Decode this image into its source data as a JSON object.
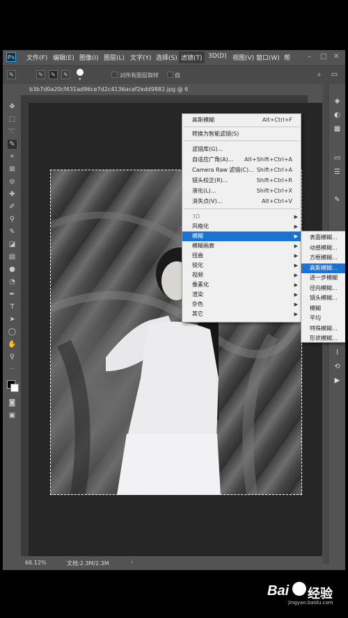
{
  "menubar": {
    "logo": "Ps",
    "items": [
      "文件(F)",
      "编辑(E)",
      "图像(I)",
      "图层(L)",
      "文字(Y)",
      "选择(S)",
      "滤镜(T)",
      "3D(D)",
      "视图(V)",
      "窗口(W)",
      "帮"
    ]
  },
  "options": {
    "sample_all_layers": "对所有图层取样",
    "auto_enhance": "自"
  },
  "document": {
    "tab_title": "b3b7d0a20cf431ad96ce7d2c4136acaf2edd9882.jpg @ 6",
    "zoom": "66.12%",
    "doc_size": "文档:2.3M/2.3M"
  },
  "filter_menu": {
    "items": [
      {
        "label": "高斯模糊",
        "shortcut": "Alt+Ctrl+F"
      },
      {
        "label": "转换为智能滤镜(S)",
        "shortcut": ""
      },
      {
        "label": "滤镜库(G)...",
        "shortcut": ""
      },
      {
        "label": "自适应广角(A)...",
        "shortcut": "Alt+Shift+Ctrl+A"
      },
      {
        "label": "Camera Raw 滤镜(C)...",
        "shortcut": "Shift+Ctrl+A"
      },
      {
        "label": "镜头校正(R)...",
        "shortcut": "Shift+Ctrl+R"
      },
      {
        "label": "液化(L)...",
        "shortcut": "Shift+Ctrl+X"
      },
      {
        "label": "消失点(V)...",
        "shortcut": "Alt+Ctrl+V"
      },
      {
        "label": "3D",
        "shortcut": ""
      },
      {
        "label": "风格化",
        "shortcut": ""
      },
      {
        "label": "模糊",
        "shortcut": ""
      },
      {
        "label": "模糊画廊",
        "shortcut": ""
      },
      {
        "label": "扭曲",
        "shortcut": ""
      },
      {
        "label": "锐化",
        "shortcut": ""
      },
      {
        "label": "视频",
        "shortcut": ""
      },
      {
        "label": "像素化",
        "shortcut": ""
      },
      {
        "label": "渲染",
        "shortcut": ""
      },
      {
        "label": "杂色",
        "shortcut": ""
      },
      {
        "label": "其它",
        "shortcut": ""
      }
    ],
    "highlighted": "模糊"
  },
  "blur_submenu": {
    "items": [
      "表面模糊...",
      "动感模糊...",
      "方框模糊...",
      "高斯模糊...",
      "进一步模糊",
      "径向模糊...",
      "镜头模糊...",
      "模糊",
      "平均",
      "特殊模糊...",
      "形状模糊..."
    ],
    "highlighted": "高斯模糊..."
  },
  "watermark": {
    "text": "Bai",
    "suffix": "经验",
    "url": "jingyan.baidu.com"
  },
  "colors": {
    "menu_highlight": "#1a73d1",
    "app_bg": "#535353",
    "canvas_bg": "#262626"
  }
}
